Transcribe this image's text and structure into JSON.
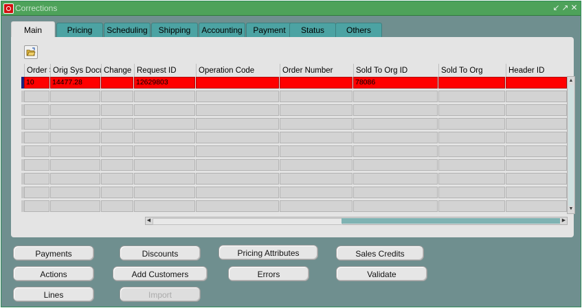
{
  "window": {
    "title": "Corrections",
    "controls": [
      "↙",
      "↗",
      "✕"
    ]
  },
  "tabs": [
    {
      "label": "Main",
      "active": true
    },
    {
      "label": "Pricing"
    },
    {
      "label": "Scheduling"
    },
    {
      "label": "Shipping"
    },
    {
      "label": "Accounting"
    },
    {
      "label": "Payment"
    },
    {
      "label": "Status"
    },
    {
      "label": "Others"
    }
  ],
  "grid": {
    "columns": [
      "Order S",
      "Orig Sys Docu",
      "Change",
      "Request ID",
      "Operation Code",
      "Order Number",
      "Sold To Org ID",
      "Sold To Org",
      "Header ID"
    ],
    "rows": [
      [
        "10",
        "14477.28",
        "",
        "12629803",
        "",
        "",
        "78086",
        "",
        ""
      ]
    ]
  },
  "buttons": {
    "payments": "Payments",
    "discounts": "Discounts",
    "pricing_attributes": "Pricing Attributes",
    "sales_credits": "Sales Credits",
    "actions": "Actions",
    "add_customers": "Add Customers",
    "errors": "Errors",
    "validate": "Validate",
    "lines": "Lines",
    "import": "Import"
  }
}
